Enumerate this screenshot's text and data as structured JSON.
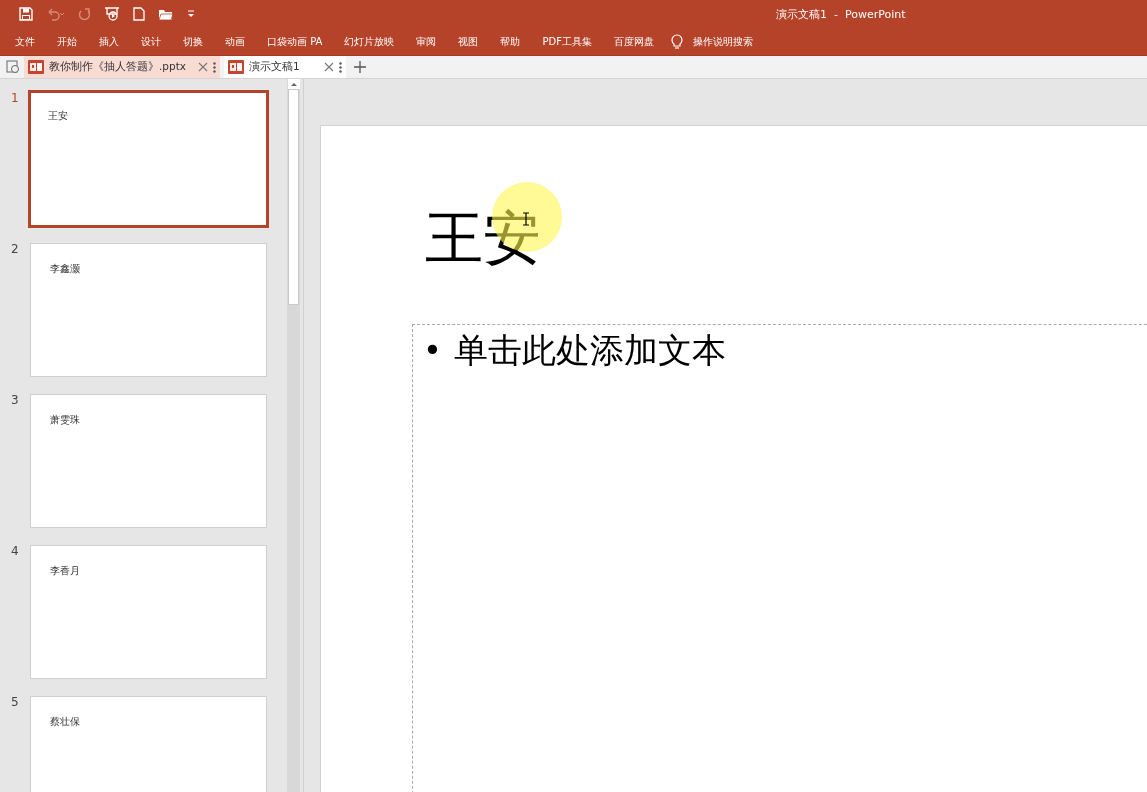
{
  "window": {
    "title": "演示文稿1  -  PowerPoint"
  },
  "ribbon_tabs": [
    {
      "label": "文件",
      "selected": false
    },
    {
      "label": "开始",
      "selected": false
    },
    {
      "label": "插入",
      "selected": false
    },
    {
      "label": "设计",
      "selected": false
    },
    {
      "label": "切换",
      "selected": false
    },
    {
      "label": "动画",
      "selected": false
    },
    {
      "label": "口袋动画 PA",
      "selected": false
    },
    {
      "label": "幻灯片放映",
      "selected": false
    },
    {
      "label": "审阅",
      "selected": false
    },
    {
      "label": "视图",
      "selected": false
    },
    {
      "label": "帮助",
      "selected": false
    },
    {
      "label": "PDF工具集",
      "selected": false
    },
    {
      "label": "百度网盘",
      "selected": false
    }
  ],
  "tell_me": {
    "placeholder": "操作说明搜索"
  },
  "document_tabs": [
    {
      "label": "教你制作《抽人答题》.pptx",
      "selected": false
    },
    {
      "label": "演示文稿1",
      "selected": true
    }
  ],
  "slides": [
    {
      "number": "1",
      "title": "王安",
      "selected": true
    },
    {
      "number": "2",
      "title": "李鑫灏",
      "selected": false
    },
    {
      "number": "3",
      "title": "萧雯珠",
      "selected": false
    },
    {
      "number": "4",
      "title": "李香月",
      "selected": false
    },
    {
      "number": "5",
      "title": "蔡壮保",
      "selected": false
    }
  ],
  "current_slide": {
    "title": "王安",
    "bullet": "•",
    "body_placeholder": "单击此处添加文本"
  }
}
